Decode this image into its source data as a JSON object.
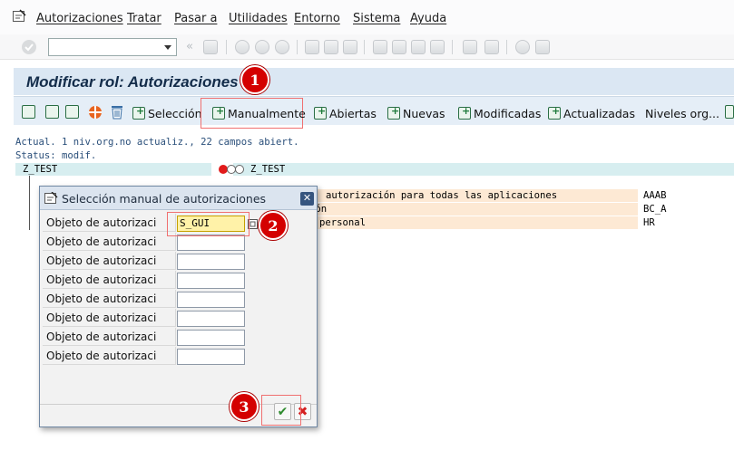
{
  "menubar": {
    "items": [
      "Autorizaciones",
      "Tratar",
      "Pasar a",
      "Utilidades",
      "Entorno",
      "Sistema",
      "Ayuda"
    ]
  },
  "toolbar": {
    "command_field_value": ""
  },
  "page": {
    "title": "Modificar rol: Autorizaciones"
  },
  "app_toolbar": {
    "buttons": [
      "Selección",
      "Manualmente",
      "Abiertas",
      "Nuevas",
      "Modificadas",
      "Actualizadas",
      "Niveles org..."
    ]
  },
  "status": {
    "line1": "Actual. 1 niv.org.no actualiz., 22 campos abiert.",
    "line2": "Status: modif."
  },
  "tree": {
    "root_name": "Z_TEST",
    "root_value": "Z_TEST",
    "rows": [
      {
        "text": "autorización para todas las aplicaciones",
        "code": "AAAB"
      },
      {
        "text": "ión",
        "code": "BC_A"
      },
      {
        "text": "personal",
        "code": "HR"
      }
    ]
  },
  "dialog": {
    "title": "Selección manual de autorizaciones",
    "rows": [
      {
        "label": "Objeto de autorizaci",
        "value": "S_GUI"
      },
      {
        "label": "Objeto de autorizaci",
        "value": ""
      },
      {
        "label": "Objeto de autorizaci",
        "value": ""
      },
      {
        "label": "Objeto de autorizaci",
        "value": ""
      },
      {
        "label": "Objeto de autorizaci",
        "value": ""
      },
      {
        "label": "Objeto de autorizaci",
        "value": ""
      },
      {
        "label": "Objeto de autorizaci",
        "value": ""
      },
      {
        "label": "Objeto de autorizaci",
        "value": ""
      }
    ]
  },
  "callouts": [
    "1",
    "2",
    "3"
  ],
  "colors": {
    "title_bg": "#dbe7f3",
    "highlight_row": "#fde9d4",
    "accent_blue": "#36557f",
    "callout_red": "#d40000"
  }
}
